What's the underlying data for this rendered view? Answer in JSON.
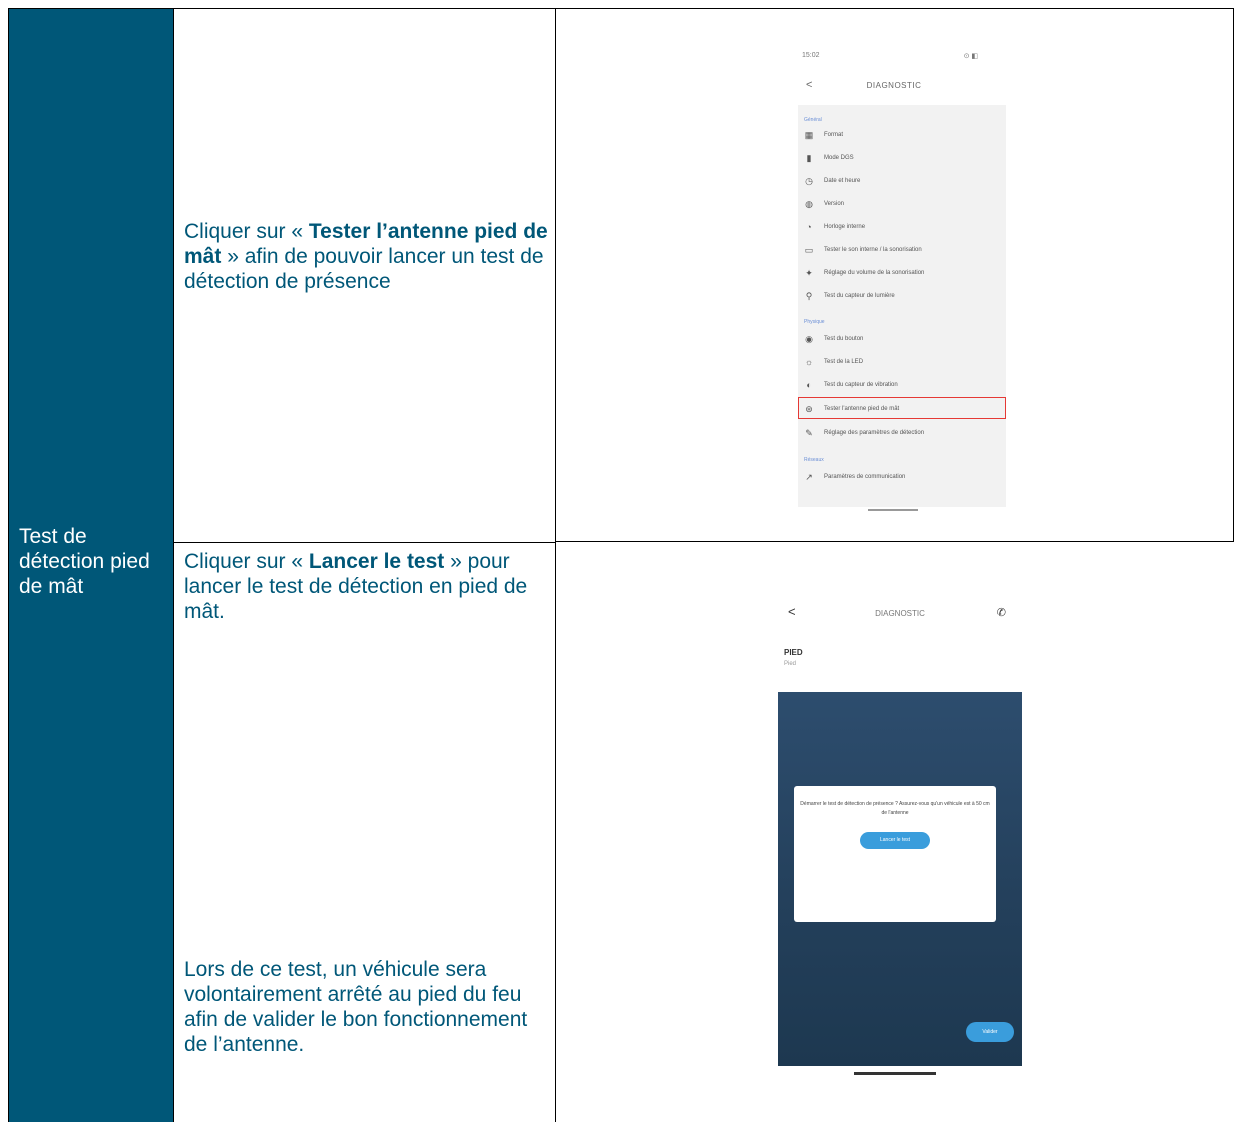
{
  "row_label": "Test de détection pied de mât",
  "step1": {
    "prefix": "Cliquer sur « ",
    "bold": "Tester l’antenne pied de mât",
    "suffix": " » afin de pouvoir lancer un test de détection de présence"
  },
  "step2": {
    "prefix": "Cliquer sur « ",
    "bold": "Lancer le test",
    "suffix": " » pour lancer le test de détection en pied de mât."
  },
  "step2_note": "Lors de ce test, un véhicule sera volontairement arrêté au pied du feu afin de valider le bon fonctionnement de l’antenne.",
  "screen1": {
    "status_time": "15:02",
    "status_icons": "⊙ ◧",
    "header_back": "<",
    "header_title": "DIAGNOSTIC",
    "section_a": "Général",
    "section_b": "Physique",
    "section_c": "Réseaux",
    "items": [
      {
        "icon": "▦",
        "label": "Format"
      },
      {
        "icon": "▮",
        "label": "Mode DGS"
      },
      {
        "icon": "◷",
        "label": "Date et heure"
      },
      {
        "icon": "◍",
        "label": "Version"
      },
      {
        "icon": "◔",
        "label": "Horloge interne"
      },
      {
        "icon": "▭",
        "label": "Tester le son interne / la sonorisation"
      },
      {
        "icon": "✦",
        "label": "Réglage du volume de la sonorisation"
      },
      {
        "icon": "⚲",
        "label": "Test du capteur de lumière"
      },
      {
        "icon": "◉",
        "label": "Test du bouton"
      },
      {
        "icon": "☼",
        "label": "Test de la LED"
      },
      {
        "icon": "◐",
        "label": "Test du capteur de vibration"
      },
      {
        "icon": "⊛",
        "label": "Tester l'antenne pied de mât"
      },
      {
        "icon": "✎",
        "label": "Réglage des paramètres de détection"
      },
      {
        "icon": "↗",
        "label": "Paramètres de communication"
      }
    ]
  },
  "screen2": {
    "header_back": "<",
    "header_title": "DIAGNOSTIC",
    "title": "PIED",
    "subtitle": "Pied",
    "dialog_text": "Démarrer le test de détection de présence ? Assurez-vous qu'un véhicule est à 50 cm de l'antenne",
    "dialog_button": "Lancer le test",
    "fab_label": "Valider"
  }
}
